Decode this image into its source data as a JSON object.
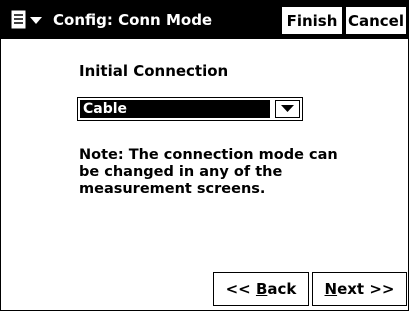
{
  "titlebar": {
    "title": "Config: Conn Mode",
    "finish_label": "Finish",
    "cancel_label": "Cancel",
    "start_icon": "start-menu-icon"
  },
  "main": {
    "initial_connection_label": "Initial Connection",
    "connection_select": {
      "value": "Cable",
      "arrow_icon": "chevron-down-icon"
    },
    "note": "Note: The connection mode can be changed in any of the measurement screens."
  },
  "footer": {
    "back": {
      "prefix": "<< ",
      "accel": "B",
      "rest": "ack"
    },
    "next": {
      "accel": "N",
      "rest": "ext >>"
    }
  }
}
